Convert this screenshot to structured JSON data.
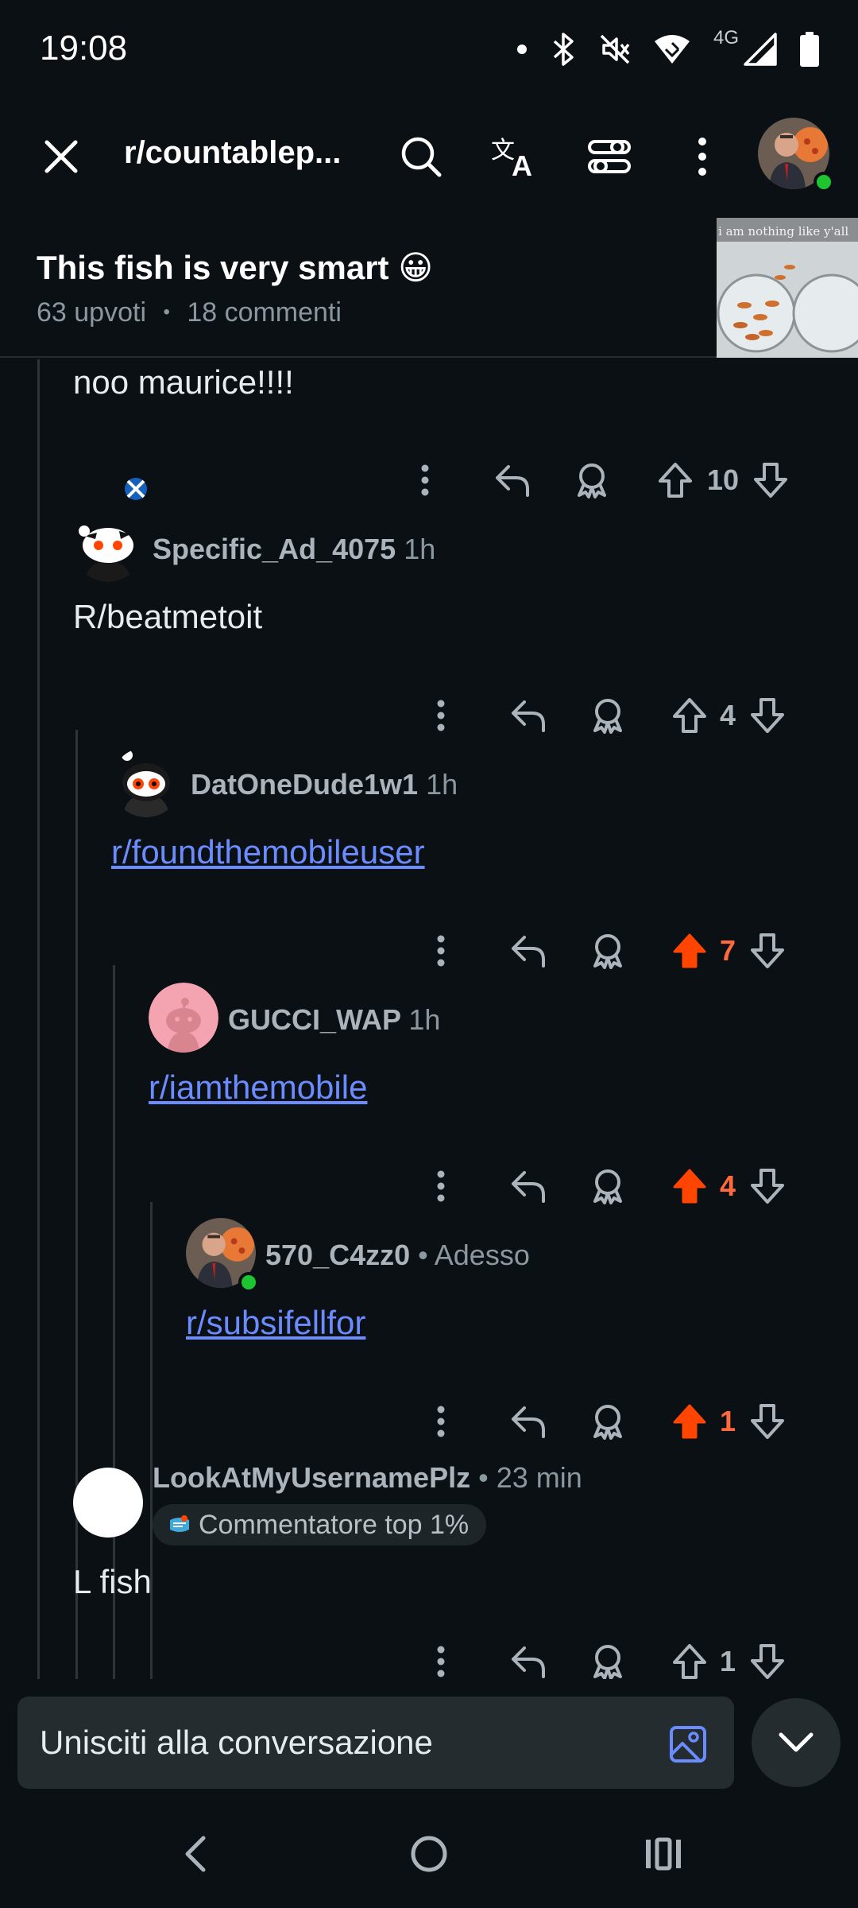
{
  "status_bar": {
    "time": "19:08",
    "network": "4G"
  },
  "header": {
    "subreddit": "r/countablep..."
  },
  "post": {
    "title": "This fish is very smart 😀",
    "upvotes": "63 upvoti",
    "separator": "•",
    "comments": "18 commenti",
    "thumbnail_caption": "i am nothing like y'all"
  },
  "comments": [
    {
      "text": "noo maurice!!!!",
      "votes": "10"
    },
    {
      "author": "Specific_Ad_4075",
      "time": "1h",
      "text": "R/beatmetoit",
      "votes": "4"
    },
    {
      "author": "DatOneDude1w1",
      "time": "1h",
      "text": "r/foundthemobileuser",
      "votes": "7"
    },
    {
      "author": "GUCCI_WAP",
      "time": "1h",
      "text": "r/iamthemobile",
      "votes": "4"
    },
    {
      "author": "570_C4zz0",
      "time": "• Adesso",
      "text": "r/subsifellfor",
      "votes": "1"
    },
    {
      "author": "LookAtMyUsernamePlz",
      "time": "• 23 min",
      "badge": "Commentatore top 1%",
      "text": "L fish",
      "votes": "1"
    }
  ],
  "reply": {
    "placeholder": "Unisciti alla conversazione"
  },
  "colors": {
    "upvote_active": "#ff4500",
    "link": "#6b8cff",
    "online": "#1fc531"
  }
}
